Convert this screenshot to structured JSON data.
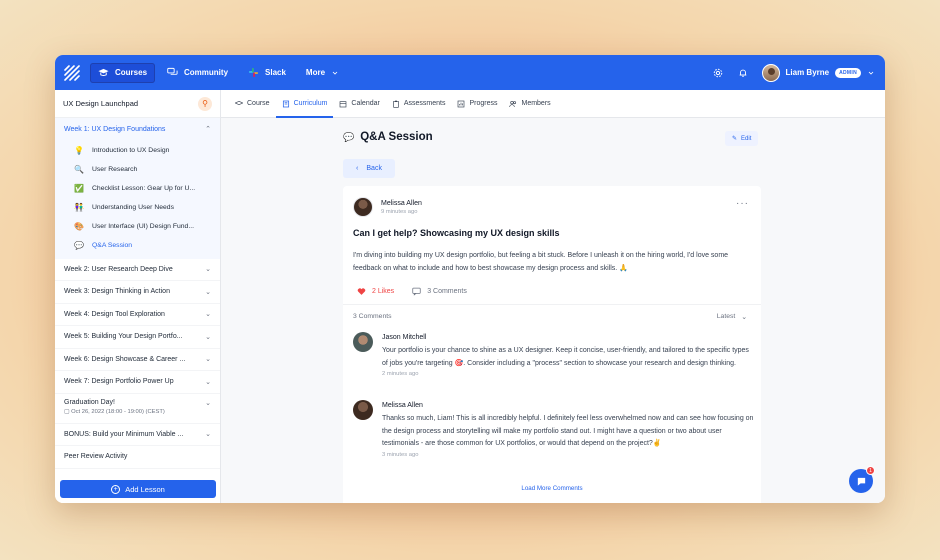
{
  "topnav": {
    "items": [
      {
        "label": "Courses",
        "icon": "graduation-cap-icon",
        "active": true
      },
      {
        "label": "Community",
        "icon": "chat-bubbles-icon",
        "active": false
      },
      {
        "label": "Slack",
        "icon": "slack-icon",
        "active": false
      },
      {
        "label": "More",
        "icon": "chevron-down-icon",
        "active": false
      }
    ],
    "user_name": "Liam Byrne",
    "user_badge": "ADMIN"
  },
  "sidebar": {
    "course_title": "UX Design Launchpad",
    "open_week": "Week 1: UX Design Foundations",
    "lessons": [
      {
        "icon": "💡",
        "label": "Introduction to UX Design"
      },
      {
        "icon": "🔍",
        "label": "User Research"
      },
      {
        "icon": "✅",
        "label": "Checklist Lesson: Gear Up for U..."
      },
      {
        "icon": "👫",
        "label": "Understanding User Needs"
      },
      {
        "icon": "🎨",
        "label": "User Interface (UI) Design Fund..."
      },
      {
        "icon": "💬",
        "label": "Q&A Session"
      }
    ],
    "weeks": [
      "Week 2: User Research Deep Dive",
      "Week 3: Design Thinking in Action",
      "Week 4: Design Tool Exploration",
      "Week 5: Building Your Design Portfo...",
      "Week 6: Design Showcase & Career ...",
      "Week 7: Design Portfolio Power Up"
    ],
    "graduation": {
      "title": "Graduation Day!",
      "date": "Oct 26, 2022 (18:00 - 19:00) (CEST)"
    },
    "bonus": "BONUS: Build your Minimum Viable ...",
    "peer_review": "Peer Review Activity",
    "add_lesson": "Add Lesson"
  },
  "tabs": [
    {
      "label": "Course",
      "active": false
    },
    {
      "label": "Curriculum",
      "active": true
    },
    {
      "label": "Calendar",
      "active": false
    },
    {
      "label": "Assessments",
      "active": false
    },
    {
      "label": "Progress",
      "active": false
    },
    {
      "label": "Members",
      "active": false
    }
  ],
  "page": {
    "title": "Q&A Session",
    "edit": "Edit",
    "back": "Back"
  },
  "post": {
    "author": "Melissa Allen",
    "time": "9 minutes ago",
    "title": "Can I get help? Showcasing my UX design skills",
    "body": "I'm diving into building my UX design portfolio, but feeling a bit stuck.  Before I unleash it on the hiring world, I'd love some feedback on what to include and how to best showcase my design process and skills. 🙏",
    "likes": "2 Likes",
    "comments": "3 Comments"
  },
  "comments_section": {
    "count_label": "3 Comments",
    "sort": "Latest",
    "load_more": "Load More Comments",
    "items": [
      {
        "author": "Jason Mitchell",
        "text": "Your portfolio is your chance to shine as a UX designer.  Keep it concise, user-friendly, and tailored to the specific types of jobs you're targeting 🎯.  Consider including a \"process\" section to showcase your research and design thinking.",
        "time": "2 minutes ago"
      },
      {
        "author": "Melissa Allen",
        "text": "Thanks so much, Liam!  This is all incredibly helpful.  I definitely feel less overwhelmed now and can see how focusing on the design process and storytelling will make my portfolio stand out.  I might have a question or two about user testimonials -  are those common for UX portfolios, or would that depend on the project?✌",
        "time": "3 minutes ago"
      }
    ]
  },
  "chat": {
    "badge": "1"
  },
  "colors": {
    "primary": "#2563eb",
    "like": "#ef4444"
  }
}
